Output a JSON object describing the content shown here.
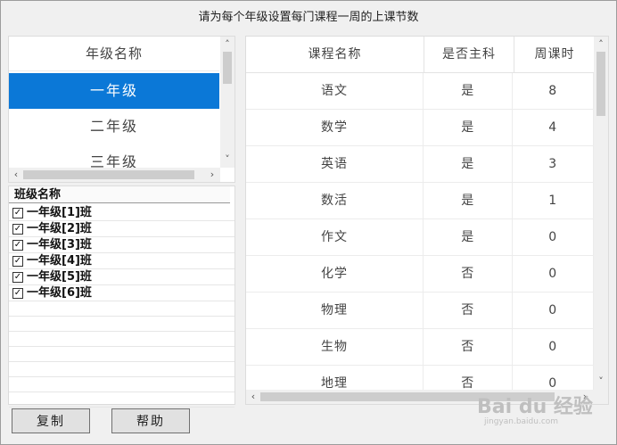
{
  "dialog": {
    "title": "请为每个年级设置每门课程一周的上课节数"
  },
  "grade_list": {
    "header": "年级名称",
    "items": [
      "一年级",
      "二年级",
      "三年级"
    ],
    "selected_index": 0
  },
  "class_list": {
    "header": "班级名称",
    "items": [
      {
        "label": "一年级[1]班",
        "checked": true
      },
      {
        "label": "一年级[2]班",
        "checked": true
      },
      {
        "label": "一年级[3]班",
        "checked": true
      },
      {
        "label": "一年级[4]班",
        "checked": true
      },
      {
        "label": "一年级[5]班",
        "checked": true
      },
      {
        "label": "一年级[6]班",
        "checked": true
      }
    ]
  },
  "course_table": {
    "columns": [
      "课程名称",
      "是否主科",
      "周课时"
    ],
    "rows": [
      [
        "语文",
        "是",
        "8"
      ],
      [
        "数学",
        "是",
        "4"
      ],
      [
        "英语",
        "是",
        "3"
      ],
      [
        "数活",
        "是",
        "1"
      ],
      [
        "作文",
        "是",
        "0"
      ],
      [
        "化学",
        "否",
        "0"
      ],
      [
        "物理",
        "否",
        "0"
      ],
      [
        "生物",
        "否",
        "0"
      ],
      [
        "地理",
        "否",
        "0"
      ]
    ]
  },
  "buttons": {
    "copy": "复制",
    "help": "帮助"
  },
  "watermark": {
    "brand": "Bai du 经验",
    "url": "jingyan.baidu.com"
  },
  "icons": {
    "scroll_up": "chevron-up-icon",
    "scroll_down": "chevron-down-icon",
    "scroll_left": "chevron-left-icon",
    "scroll_right": "chevron-right-icon",
    "checkbox": "checkbox-checked-icon"
  },
  "colors": {
    "selection": "#0b78d7",
    "background": "#f0f0f0"
  }
}
